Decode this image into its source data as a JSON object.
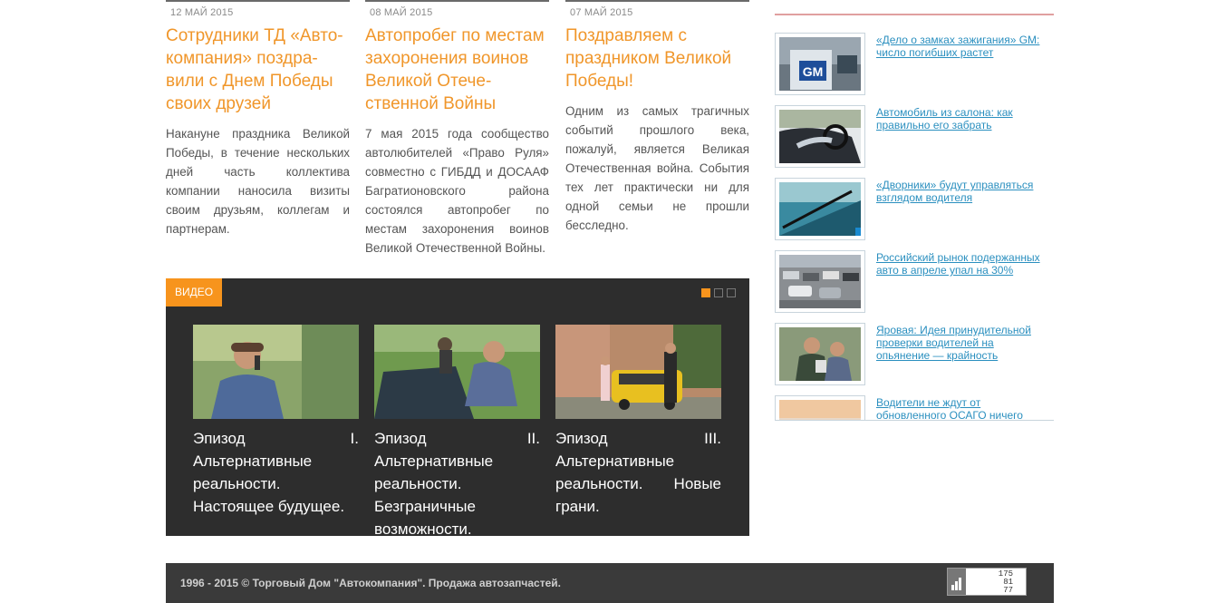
{
  "news": [
    {
      "date": "12 май 2015",
      "title": "Сотрудники ТД «Ав­то­ком­па­ния» поздра­вили с Днем Победы своих друзей",
      "text": "Накануне праздника Великой Победы, в течение нескольких дней часть коллектива компании наносила визиты своим друзьям, коллегам и партнерам."
    },
    {
      "date": "08 май 2015",
      "title": "Автопробег по ме­стам захоронения во­инов Великой Отече­ственной Войны",
      "text": "7 мая 2015 года сообщество автолюбителей «Право Руля» совместно с ГИБДД и ДОСААФ Багратионовского района состоялся автопробег по местам захоронения воинов Великой Отечественной Войны."
    },
    {
      "date": "07 май 2015",
      "title": "Поздравляем с праздником Великой Победы!",
      "text": "Одним из самых трагичных событий прошлого века, пожалуй, является Великая Отечественная война. События тех лет практически ни для одной семьи не прошли бесследно."
    }
  ],
  "video": {
    "label": "ВИДЕО",
    "episodes": [
      {
        "caption": "Эпизод I. Альтернативные реальности. Настоящее будущее."
      },
      {
        "caption": "Эпизод II. Альтернативные реальности. Безграничные возможности."
      },
      {
        "caption": "Эпизод III. Альтернативные реальности. Новые грани."
      }
    ]
  },
  "sidebar": {
    "items": [
      {
        "title": "«Дело о замках зажигания» GM: число погибших растет",
        "thumb_text": "GM"
      },
      {
        "title": "Автомобиль из салона: как правильно его забрать"
      },
      {
        "title": "«Дворники» будут управляться взглядом водителя"
      },
      {
        "title": "Российский рынок подержанных авто в апреле упал на 30%"
      },
      {
        "title": "Яровая: Идея принудительной проверки водителей на опьянение — крайность"
      },
      {
        "title": "Водители не ждут от обновленного ОСАГО ничего хорошего"
      }
    ]
  },
  "footer": {
    "copyright": "1996 - 2015 © Торговый Дом \"Автокомпания\". Продажа автозапчастей.",
    "counter": [
      "175",
      "81",
      "77"
    ]
  },
  "colors": {
    "accent": "#f7941d",
    "title": "#f0962a",
    "link": "#2a8fbf",
    "dark_panel": "#2d2d2d",
    "footer": "#3a3a3a"
  }
}
